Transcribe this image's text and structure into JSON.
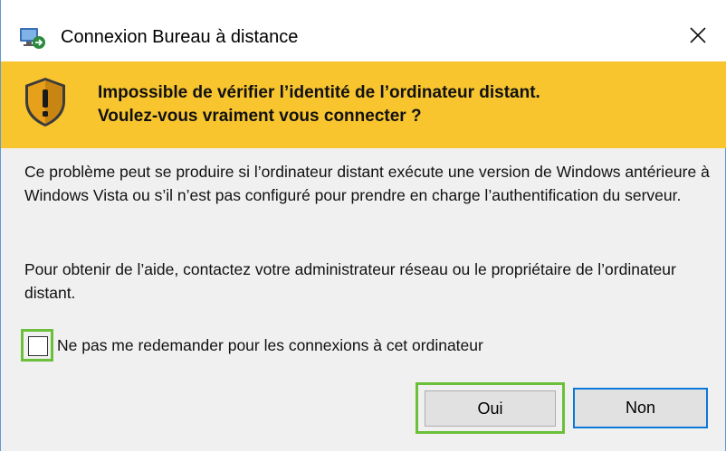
{
  "window": {
    "title": "Connexion Bureau à distance"
  },
  "banner": {
    "line1": "Impossible de vérifier l’identité de l’ordinateur distant.",
    "line2": "Voulez-vous vraiment vous connecter ?"
  },
  "body": {
    "paragraph1": "Ce problème peut se produire si l’ordinateur distant exécute une version de Windows antérieure à Windows Vista ou s’il n’est pas configuré pour prendre en charge l’authentification du serveur.",
    "paragraph2": "Pour obtenir de l’aide, contactez votre administrateur réseau ou le propriétaire de l’ordinateur distant."
  },
  "checkbox": {
    "label": "Ne pas me redemander pour les connexions à cet ordinateur",
    "checked": false
  },
  "buttons": {
    "yes_label": "Oui",
    "no_label": "Non"
  },
  "icons": {
    "app": "remote-desktop-icon",
    "warning": "warning-shield-icon",
    "close": "close-icon"
  },
  "colors": {
    "banner": "#f8c52f",
    "highlight_green": "#6cbf3a",
    "focus_blue": "#0a78d7",
    "window_bg": "#f0f0f0"
  }
}
